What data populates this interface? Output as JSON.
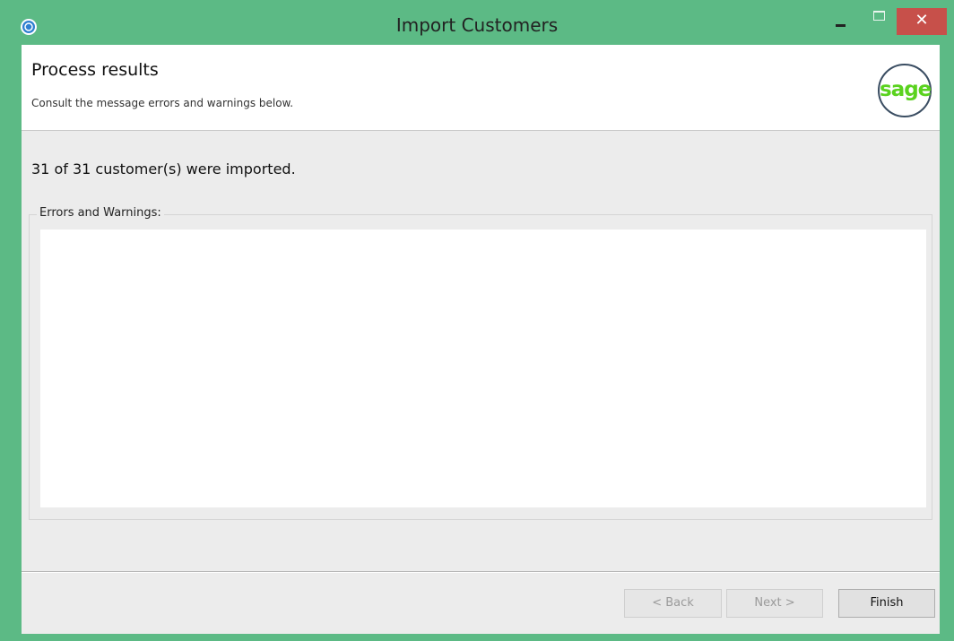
{
  "window": {
    "title": "Import Customers",
    "close_glyph": "✕",
    "accent_color": "#5cba85",
    "close_color": "#c7504a"
  },
  "header": {
    "title": "Process results",
    "subtitle": "Consult the message errors and warnings below.",
    "logo_text": "sage"
  },
  "result": {
    "summary": "31 of 31 customer(s) were imported."
  },
  "messages_group": {
    "label": "Errors and Warnings:",
    "items": []
  },
  "footer": {
    "back_label": "< Back",
    "next_label": "Next >",
    "finish_label": "Finish"
  }
}
